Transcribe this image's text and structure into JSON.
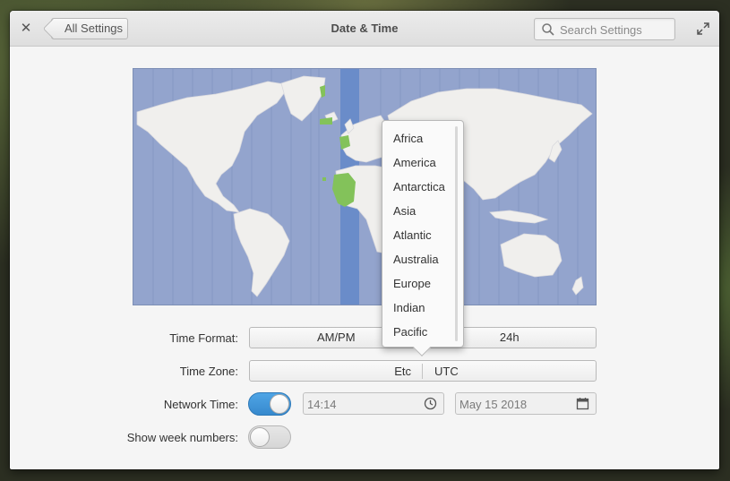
{
  "window": {
    "title": "Date & Time",
    "back_label": "All Settings",
    "search_placeholder": "Search Settings"
  },
  "time_format": {
    "label": "Time Format:",
    "options": [
      "AM/PM",
      "24h"
    ]
  },
  "time_zone": {
    "label": "Time Zone:",
    "region": "Etc",
    "city": "UTC"
  },
  "network_time": {
    "label": "Network Time:",
    "enabled": true,
    "time_value": "14:14",
    "date_value": "May 15 2018"
  },
  "week_numbers": {
    "label": "Show week numbers:",
    "enabled": false
  },
  "region_popover": {
    "items": [
      "Africa",
      "America",
      "Antarctica",
      "Asia",
      "Atlantic",
      "Australia",
      "Europe",
      "Indian",
      "Pacific"
    ]
  },
  "colors": {
    "map_ocean": "#93a4cd",
    "map_land": "#f0efed",
    "selected_zone_band": "#6a8cc9",
    "selected_zone_land": "#83c25a",
    "switch_on": "#3d8fd3"
  },
  "icons": {
    "close": "close-icon",
    "back": "chevron-left-icon",
    "search": "search-icon",
    "maximize": "maximize-icon",
    "clock": "clock-icon",
    "calendar": "calendar-icon"
  }
}
